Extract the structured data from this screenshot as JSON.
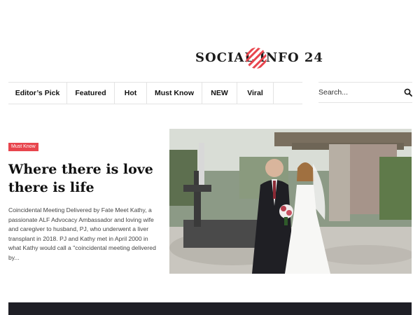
{
  "site": {
    "logo_text": "SOCIAL INFO 24",
    "accent_color": "#e8454d"
  },
  "nav": {
    "items": [
      {
        "label": "Editor’s Pick"
      },
      {
        "label": "Featured"
      },
      {
        "label": "Hot"
      },
      {
        "label": "Must Know"
      },
      {
        "label": "NEW"
      },
      {
        "label": "Viral"
      }
    ]
  },
  "search": {
    "placeholder": "Search...",
    "icon": "search-icon"
  },
  "article": {
    "category": "Must Know",
    "title": "Where there is love there is life",
    "excerpt": "Coincidental Meeting Delivered by Fate Meet Kathy, a passionate ALF Advocacy Ambassador and loving wife and caregiver to husband, PJ, who underwent a liver transplant in 2018. PJ and Kathy met in April 2000 in what Kathy would call a \"coincidental meeting delivered by..."
  }
}
